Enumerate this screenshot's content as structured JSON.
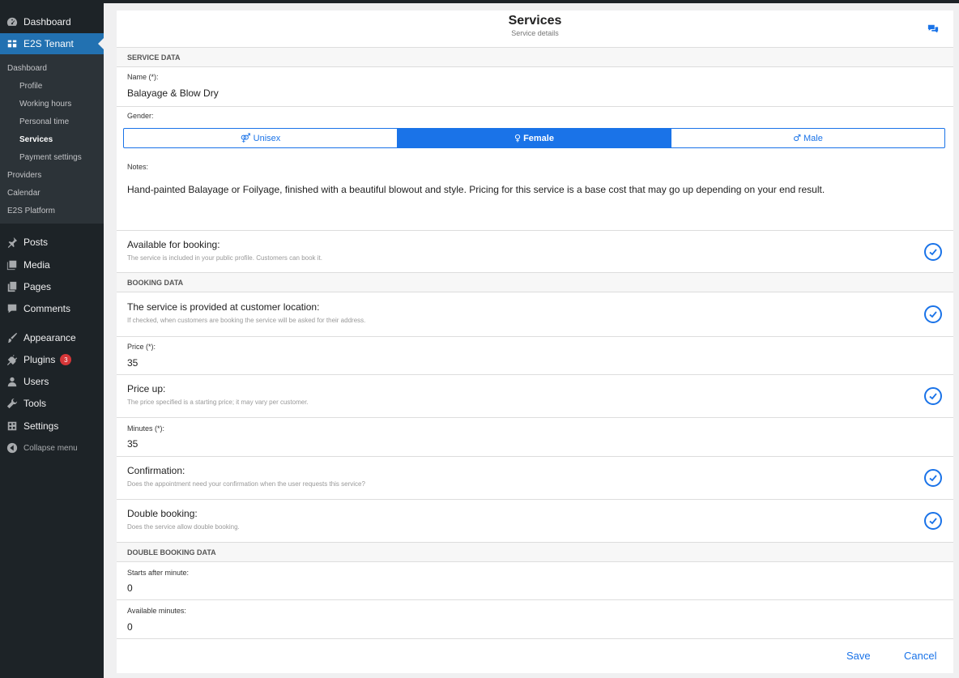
{
  "sidebar": {
    "top": [
      {
        "label": "Dashboard",
        "icon": "dashboard-icon"
      },
      {
        "label": "E2S Tenant",
        "icon": "tenant-icon",
        "active": true
      }
    ],
    "submenu": [
      {
        "label": "Dashboard",
        "level": 1
      },
      {
        "label": "Profile",
        "level": 2
      },
      {
        "label": "Working hours",
        "level": 2
      },
      {
        "label": "Personal time",
        "level": 2
      },
      {
        "label": "Services",
        "level": 2,
        "current": true
      },
      {
        "label": "Payment settings",
        "level": 2
      },
      {
        "label": "Providers",
        "level": 1
      },
      {
        "label": "Calendar",
        "level": 1
      },
      {
        "label": "E2S Platform",
        "level": 1
      }
    ],
    "bottom": [
      {
        "label": "Posts",
        "icon": "pin-icon"
      },
      {
        "label": "Media",
        "icon": "media-icon"
      },
      {
        "label": "Pages",
        "icon": "pages-icon"
      },
      {
        "label": "Comments",
        "icon": "comment-icon"
      },
      {
        "label": "Appearance",
        "icon": "brush-icon"
      },
      {
        "label": "Plugins",
        "icon": "plugin-icon",
        "badge": "3"
      },
      {
        "label": "Users",
        "icon": "user-icon"
      },
      {
        "label": "Tools",
        "icon": "wrench-icon"
      },
      {
        "label": "Settings",
        "icon": "settings-icon"
      },
      {
        "label": "Collapse menu",
        "icon": "collapse-icon"
      }
    ]
  },
  "header": {
    "title": "Services",
    "subtitle": "Service details"
  },
  "sections": {
    "service_data": "SERVICE DATA",
    "booking_data": "BOOKING DATA",
    "double_booking_data": "DOUBLE BOOKING DATA"
  },
  "form": {
    "name_label": "Name (*):",
    "name_value": "Balayage & Blow Dry",
    "gender_label": "Gender:",
    "gender_options": [
      {
        "label": "Unisex",
        "symbol": "⚤"
      },
      {
        "label": "Female",
        "symbol": "♀",
        "selected": true
      },
      {
        "label": "Male",
        "symbol": "♂"
      }
    ],
    "notes_label": "Notes:",
    "notes_value": "Hand-painted Balayage or Foilyage, finished with a beautiful blowout and style. Pricing for this service is a base cost that may go up depending on your end result.",
    "available": {
      "title": "Available for booking:",
      "desc": "The service is included in your public profile. Customers can book it."
    },
    "customer_location": {
      "title": "The service is provided at customer location:",
      "desc": "If checked, when customers are booking the service will be asked for their address."
    },
    "price_label": "Price (*):",
    "price_value": "35",
    "price_up": {
      "title": "Price up:",
      "desc": "The price specified is a starting price; it may vary per customer."
    },
    "minutes_label": "Minutes (*):",
    "minutes_value": "35",
    "confirmation": {
      "title": "Confirmation:",
      "desc": "Does the appointment need your confirmation when the user requests this service?"
    },
    "double_booking": {
      "title": "Double booking:",
      "desc": "Does the service allow double booking."
    },
    "starts_after_label": "Starts after minute:",
    "starts_after_value": "0",
    "available_minutes_label": "Available minutes:",
    "available_minutes_value": "0"
  },
  "actions": {
    "save": "Save",
    "cancel": "Cancel"
  },
  "colors": {
    "accent": "#1a73e8",
    "sidebar": "#1d2327",
    "active_menu": "#2271b1"
  }
}
